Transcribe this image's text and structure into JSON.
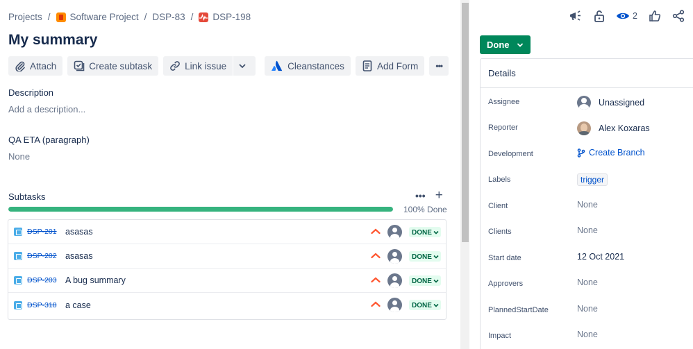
{
  "breadcrumb": {
    "projects": "Projects",
    "project": "Software Project",
    "parent": "DSP-83",
    "issue": "DSP-198",
    "separator": "/"
  },
  "issue": {
    "title": "My summary"
  },
  "toolbar": {
    "attach": "Attach",
    "create_subtask": "Create subtask",
    "link_issue": "Link issue",
    "cleanstances": "Cleanstances",
    "add_form": "Add Form",
    "more": "•••"
  },
  "description": {
    "label": "Description",
    "placeholder": "Add a description..."
  },
  "qa_eta": {
    "label": "QA ETA (paragraph)",
    "value": "None"
  },
  "subtasks": {
    "label": "Subtasks",
    "more": "•••",
    "add": "+",
    "progress_text": "100% Done",
    "progress_fraction": 1.0,
    "items": [
      {
        "key": "DSP-201",
        "summary": "asasas",
        "status": "DONE"
      },
      {
        "key": "DSP-202",
        "summary": "asasas",
        "status": "DONE"
      },
      {
        "key": "DSP-203",
        "summary": "A bug summary",
        "status": "DONE"
      },
      {
        "key": "DSP-318",
        "summary": "a case",
        "status": "DONE"
      }
    ]
  },
  "header_actions": {
    "watch_count": "2"
  },
  "status_button": {
    "label": "Done"
  },
  "details": {
    "heading": "Details",
    "fields": [
      {
        "label": "Assignee",
        "value": "Unassigned"
      },
      {
        "label": "Reporter",
        "value": "Alex Koxaras"
      },
      {
        "label": "Development",
        "value": "Create Branch"
      },
      {
        "label": "Labels",
        "value": "trigger"
      },
      {
        "label": "Client",
        "value": "None"
      },
      {
        "label": "Clients",
        "value": "None"
      },
      {
        "label": "Start date",
        "value": "12 Oct 2021"
      },
      {
        "label": "Approvers",
        "value": "None"
      },
      {
        "label": "PlannedStartDate",
        "value": "None"
      },
      {
        "label": "Impact",
        "value": "None"
      }
    ]
  },
  "colors": {
    "accent": "#0052cc",
    "success": "#00875a",
    "progress": "#36b37e",
    "priority": "#ff5630"
  }
}
